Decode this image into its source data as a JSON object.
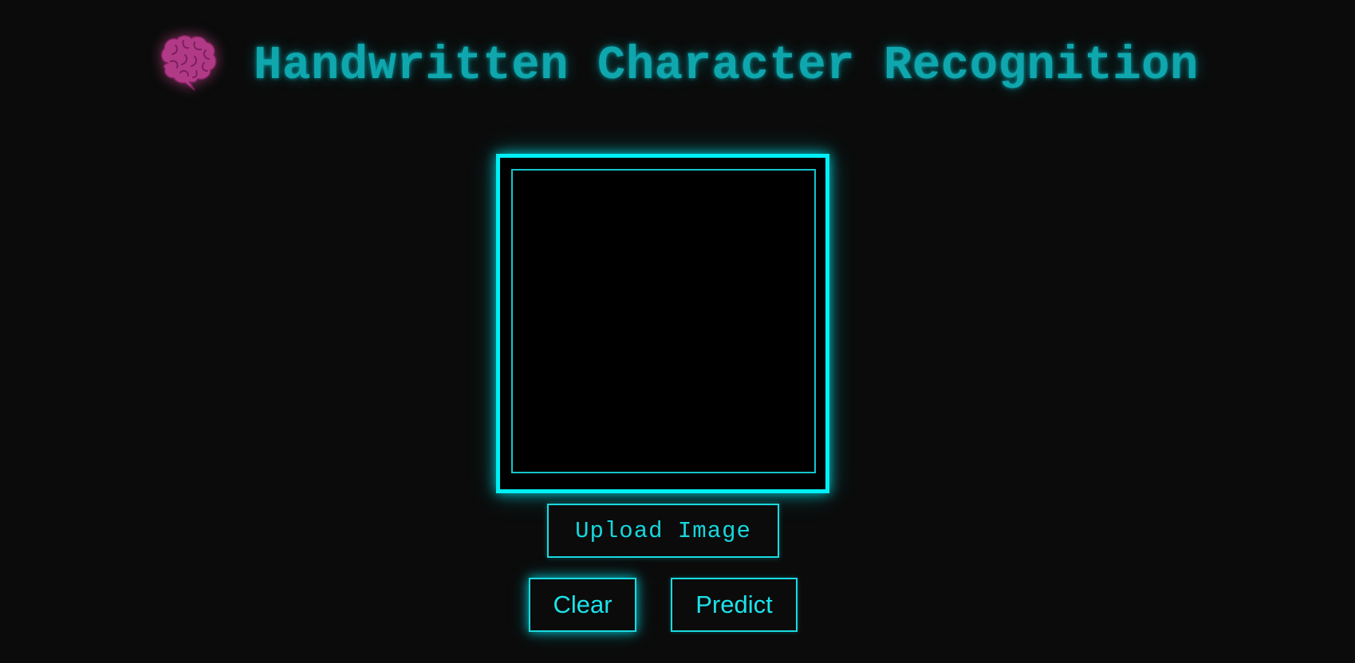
{
  "header": {
    "icon": "brain-icon",
    "title": "Handwritten Character Recognition"
  },
  "canvas": {
    "label": ""
  },
  "buttons": {
    "upload_label": "Upload Image",
    "clear_label": "Clear",
    "predict_label": "Predict"
  },
  "colors": {
    "background": "#0b0b0b",
    "accent": "#00f0f5",
    "title": "#0fa7ad",
    "brain": "#b13a86"
  }
}
